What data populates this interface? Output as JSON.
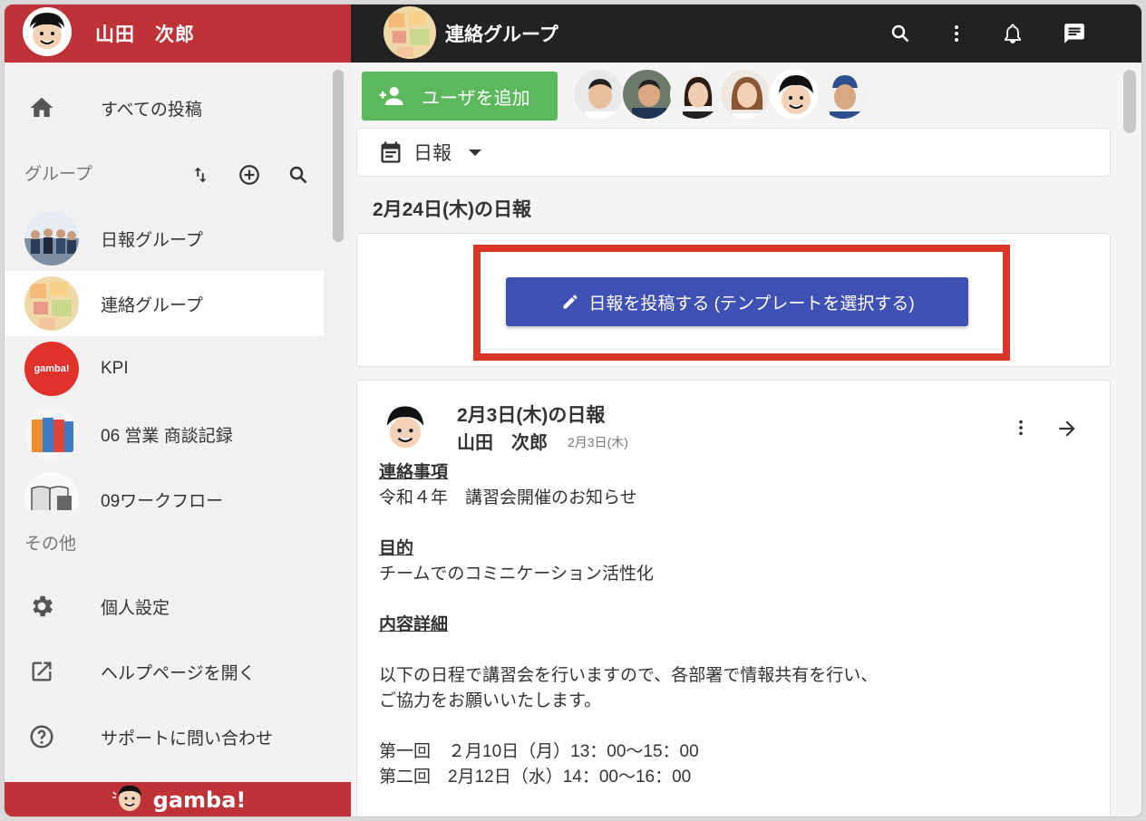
{
  "user": {
    "name": "山田　次郎"
  },
  "sidebar": {
    "all_posts_label": "すべての投稿",
    "groups_label": "グループ",
    "groups": [
      {
        "label": "日報グループ"
      },
      {
        "label": "連絡グループ"
      },
      {
        "label": "KPI",
        "avatar_text": "gamba!"
      },
      {
        "label": "06 営業 商談記録"
      },
      {
        "label": "09ワークフロー"
      }
    ],
    "other_label": "その他",
    "other_items": [
      {
        "label": "個人設定"
      },
      {
        "label": "ヘルプページを開く"
      },
      {
        "label": "サポートに問い合わせ"
      }
    ],
    "footer_brand": "gamba!"
  },
  "topbar": {
    "group_title": "連絡グループ"
  },
  "main": {
    "add_user_label": "ユーザを追加",
    "template_label": "日報",
    "date_heading": "2月24日(木)の日報",
    "post_button_label": "日報を投稿する (テンプレートを選択する)"
  },
  "report": {
    "title": "2月3日(木)の日報",
    "author": "山田　次郎",
    "date": "2月3日(木)",
    "lines": [
      {
        "text": "連絡事項",
        "heading": true
      },
      {
        "text": "令和４年　講習会開催のお知らせ",
        "heading": false
      },
      {
        "text": "目的",
        "heading": true
      },
      {
        "text": "チームでのコミニケーション活性化",
        "heading": false
      },
      {
        "text": "内容詳細",
        "heading": true
      },
      {
        "text": "以下の日程で講習会を行いますので、各部署で情報共有を行い、",
        "heading": false
      },
      {
        "text": "ご協力をお願いいたします。",
        "heading": false
      },
      {
        "text": "第一回　２月10日（月）13：00〜15：00",
        "heading": false
      },
      {
        "text": "第二回　2月12日（水）14：00〜16：00",
        "heading": false
      }
    ]
  },
  "colors": {
    "brand_red": "#bf3238",
    "primary_blue": "#3f51b5",
    "add_green": "#5cb85c",
    "highlight_red": "#d93628"
  }
}
